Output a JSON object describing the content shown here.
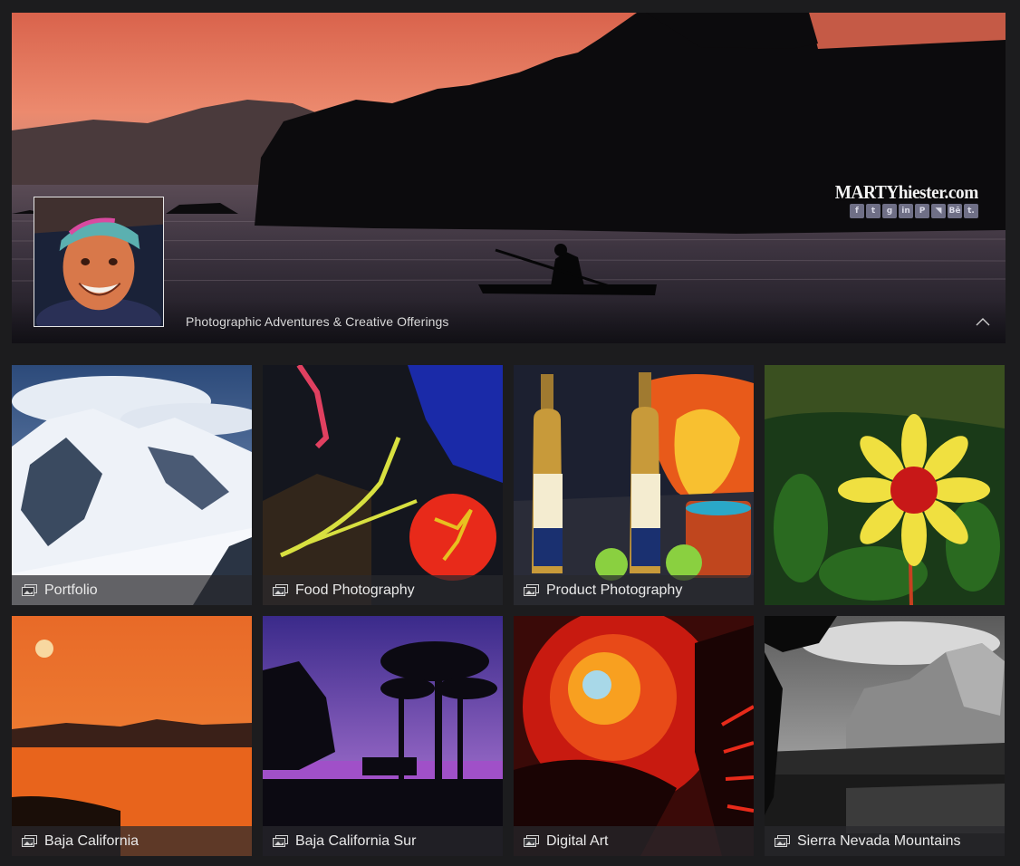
{
  "hero": {
    "tagline": "Photographic Adventures & Creative Offerings",
    "brand": "MARTYhiester.com",
    "socials": [
      {
        "icon": "facebook-icon",
        "glyph": "f"
      },
      {
        "icon": "twitter-icon",
        "glyph": "t"
      },
      {
        "icon": "google-plus-icon",
        "glyph": "g"
      },
      {
        "icon": "linkedin-icon",
        "glyph": "in"
      },
      {
        "icon": "pinterest-icon",
        "glyph": "P"
      },
      {
        "icon": "rss-icon",
        "glyph": "◥"
      },
      {
        "icon": "behance-icon",
        "glyph": "Bē"
      },
      {
        "icon": "tumblr-icon",
        "glyph": "t."
      }
    ],
    "collapse_icon": "chevron-up-icon"
  },
  "galleries": [
    {
      "title": "Portfolio",
      "icon": "gallery-icon"
    },
    {
      "title": "Food Photography",
      "icon": "gallery-icon"
    },
    {
      "title": "Product Photography",
      "icon": "gallery-icon"
    },
    {
      "title": "",
      "icon": ""
    },
    {
      "title": "Baja California",
      "icon": "gallery-icon"
    },
    {
      "title": "Baja California Sur",
      "icon": "gallery-icon"
    },
    {
      "title": "Digital Art",
      "icon": "gallery-icon"
    },
    {
      "title": "Sierra Nevada Mountains",
      "icon": "gallery-icon"
    }
  ],
  "colors": {
    "page_bg": "#1c1c1e",
    "sunset": "#e8745a",
    "label_bg": "#28282c",
    "social_bg": "#6f6f86"
  }
}
